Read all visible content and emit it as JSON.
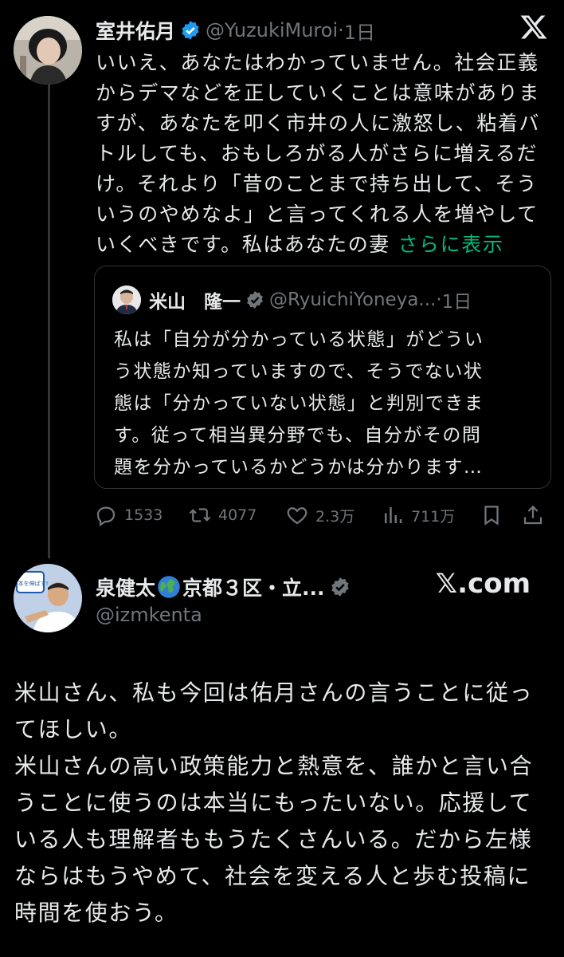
{
  "tweet1": {
    "name": "室井佑月",
    "handle": "@YuzukiMuroi",
    "separator": "·",
    "time": "1日",
    "lines": [
      "いいえ、あなたはわかっていません。社会正義",
      "からデマなどを正していくことは意味がありま",
      "すが、あなたを叩く市井の人に激怒し、粘着バ",
      "トルしても、おもしろがる人がさらに増えるだ",
      "け。それより「昔のことまで持ち出して、そう",
      "いうのやめなよ」と言ってくれる人を増やして",
      "いくべきです。私はあなたの妻"
    ],
    "more_label": "さらに表示",
    "quote": {
      "name": "米山　隆一",
      "handle": "@RyuichiYoneya...",
      "separator": "·",
      "time": "1日",
      "lines": [
        "私は「自分が分かっている状態」がどうい",
        "う状態か知っていますので、そうでない状",
        "態は「分かっていない状態」と判別できま",
        "す。従って相当異分野でも、自分がその問",
        "題を分かっているかどうかは分かります…"
      ]
    },
    "actions": {
      "replies": "1533",
      "retweets": "4077",
      "likes": "2.3万",
      "views": "711万"
    }
  },
  "tweet2": {
    "name": "泉健太",
    "name_suffix": "京都３区・立...",
    "handle": "@izmkenta",
    "watermark": "𝕏.com",
    "avatar_text": "日本を伸ばす!",
    "lines": [
      "米山さん、私も今回は佑月さんの言うことに従っ",
      "てほしい。",
      "米山さんの高い政策能力と熱意を、誰かと言い合",
      "うことに使うのは本当にもったいない。応援して",
      "いる人も理解者ももうたくさんいる。だから左様",
      "ならはもうやめて、社会を変える人と歩む投稿に",
      "時間を使おう。"
    ]
  },
  "colors": {
    "background": "#000000",
    "text": "#e7e9ea",
    "muted": "#71767b",
    "verified": "#1d9bf0",
    "link_green": "#00ba7c"
  }
}
